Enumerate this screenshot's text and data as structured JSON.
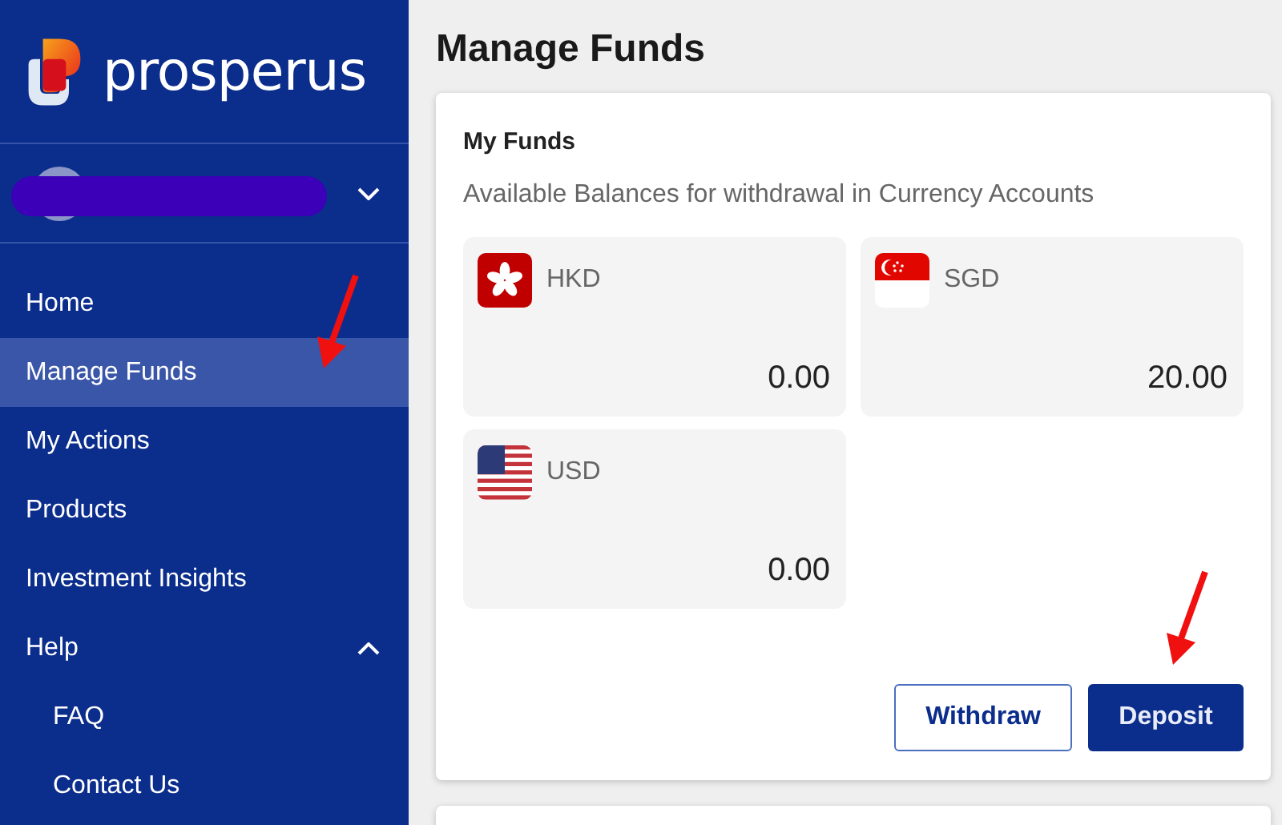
{
  "sidebar": {
    "logo": {
      "text": "prosperus"
    },
    "user": {
      "expanded": false
    },
    "nav": [
      {
        "label": "Home",
        "selected": false
      },
      {
        "label": "Manage Funds",
        "selected": true
      },
      {
        "label": "My Actions",
        "selected": false
      },
      {
        "label": "Products",
        "selected": false
      },
      {
        "label": "Investment Insights",
        "selected": false
      },
      {
        "label": "Help",
        "selected": false,
        "expanded": true,
        "children": [
          {
            "label": "FAQ",
            "selected": false
          },
          {
            "label": "Contact Us",
            "selected": false
          }
        ]
      }
    ]
  },
  "page": {
    "title": "Manage Funds"
  },
  "funds_card": {
    "title": "My Funds",
    "subtitle": "Available Balances for withdrawal in Currency Accounts",
    "accounts": [
      {
        "currency": "HKD",
        "kind": "hk",
        "balance": "0.00"
      },
      {
        "currency": "SGD",
        "kind": "sg",
        "balance": "20.00"
      },
      {
        "currency": "USD",
        "kind": "us",
        "balance": "0.00"
      }
    ],
    "buttons": [
      {
        "label": "Withdraw",
        "kind": "secondary"
      },
      {
        "label": "Deposit",
        "kind": "primary"
      }
    ]
  }
}
